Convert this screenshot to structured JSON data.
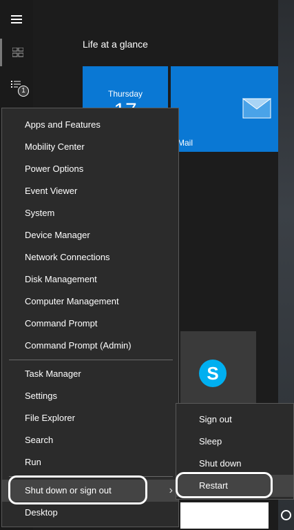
{
  "start": {
    "group_title": "Life at a glance",
    "calendar": {
      "day": "Thursday",
      "date": "17"
    },
    "mail": {
      "label": "Mail"
    },
    "badge_count": "1"
  },
  "context_menu": {
    "items": [
      {
        "label": "Apps and Features"
      },
      {
        "label": "Mobility Center"
      },
      {
        "label": "Power Options"
      },
      {
        "label": "Event Viewer"
      },
      {
        "label": "System"
      },
      {
        "label": "Device Manager"
      },
      {
        "label": "Network Connections"
      },
      {
        "label": "Disk Management"
      },
      {
        "label": "Computer Management"
      },
      {
        "label": "Command Prompt"
      },
      {
        "label": "Command Prompt (Admin)"
      },
      {
        "label": "Task Manager"
      },
      {
        "label": "Settings"
      },
      {
        "label": "File Explorer"
      },
      {
        "label": "Search"
      },
      {
        "label": "Run"
      },
      {
        "label": "Shut down or sign out"
      },
      {
        "label": "Desktop"
      }
    ],
    "chevron": "›"
  },
  "submenu": {
    "items": [
      {
        "label": "Sign out"
      },
      {
        "label": "Sleep"
      },
      {
        "label": "Shut down"
      },
      {
        "label": "Restart"
      }
    ]
  },
  "colors": {
    "tile_blue": "#0a78d4",
    "menu_bg": "#2b2b2b",
    "highlight": "#ffffff"
  },
  "icons": [
    "hamburger-icon",
    "tiles-icon",
    "all-apps-list-icon",
    "mail-envelope-icon",
    "skype-icon",
    "cortana-circle-icon",
    "chevron-right-icon"
  ]
}
